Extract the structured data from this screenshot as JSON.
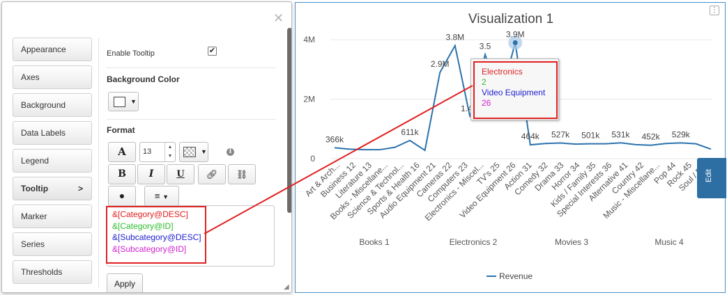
{
  "settings": {
    "tabs": [
      {
        "label": "Appearance"
      },
      {
        "label": "Axes"
      },
      {
        "label": "Background"
      },
      {
        "label": "Data Labels"
      },
      {
        "label": "Legend"
      },
      {
        "label": "Tooltip",
        "active": true,
        "arrow": ">"
      },
      {
        "label": "Marker"
      },
      {
        "label": "Series"
      },
      {
        "label": "Thresholds"
      }
    ],
    "enable_tooltip_label": "Enable Tooltip",
    "enable_tooltip_checked": true,
    "background_color_label": "Background Color",
    "format_label": "Format",
    "font_size": "13",
    "template_lines": [
      {
        "text": "&[Category@DESC]",
        "color": "#e02020"
      },
      {
        "text": "&[Category@ID]",
        "color": "#2bbd2b"
      },
      {
        "text": "&[Subcategory@DESC]",
        "color": "#2020d0"
      },
      {
        "text": "&[Subcategory@ID]",
        "color": "#d020d0"
      }
    ],
    "apply_label": "Apply"
  },
  "chart": {
    "edit_label": "Edit",
    "menu_icon": "vertical-dots-icon",
    "tooltip": [
      {
        "text": "Electronics",
        "color": "#e02020"
      },
      {
        "text": "2",
        "color": "#2bbd2b"
      },
      {
        "text": "Video Equipment",
        "color": "#2020d0"
      },
      {
        "text": "26",
        "color": "#d020d0"
      }
    ]
  },
  "chart_data": {
    "type": "line",
    "title": "Visualization 1",
    "y_ticks": [
      "0",
      "2M",
      "4M"
    ],
    "ylim": [
      0,
      4400000
    ],
    "grid": true,
    "legend_position": "bottom",
    "series": [
      {
        "name": "Revenue",
        "color": "#2a72ad",
        "values": [
          366000,
          320000,
          300000,
          300000,
          380000,
          611000,
          280000,
          2900000,
          3800000,
          1400000,
          3500000,
          2000000,
          3900000,
          464000,
          510000,
          527000,
          490000,
          501000,
          500000,
          531000,
          470000,
          452000,
          510000,
          529000,
          500000,
          320000
        ]
      }
    ],
    "data_labels": [
      {
        "index": 0,
        "text": "366k"
      },
      {
        "index": 5,
        "text": "611k"
      },
      {
        "index": 7,
        "text": "2.9M"
      },
      {
        "index": 8,
        "text": "3.8M"
      },
      {
        "index": 9,
        "text": "1.4M"
      },
      {
        "index": 10,
        "text": "3.5"
      },
      {
        "index": 12,
        "text": "3.9M"
      },
      {
        "index": 13,
        "text": "464k"
      },
      {
        "index": 15,
        "text": "527k"
      },
      {
        "index": 17,
        "text": "501k"
      },
      {
        "index": 19,
        "text": "531k"
      },
      {
        "index": 21,
        "text": "452k"
      },
      {
        "index": 23,
        "text": "529k"
      }
    ],
    "categories": [
      "Art & Arch...",
      "Business 12",
      "Literature 13",
      "Books - Miscellane...",
      "Science & Technol...",
      "Sports & Health 16",
      "Audio Equipment 21",
      "Cameras 22",
      "Computers 23",
      "Electronics - Miscel...",
      "TV's 25",
      "Video Equipment 26",
      "Action 31",
      "Comedy 32",
      "Drama 33",
      "Horror 34",
      "Kids / Family 35",
      "Special Interests 36",
      "Alternative 41",
      "Country 42",
      "Music - Miscellane...",
      "Pop 44",
      "Rock 45",
      "Soul / R..."
    ],
    "groups": [
      "Books 1",
      "Electronics 2",
      "Movies 3",
      "Music 4"
    ],
    "highlight_index": 12
  }
}
